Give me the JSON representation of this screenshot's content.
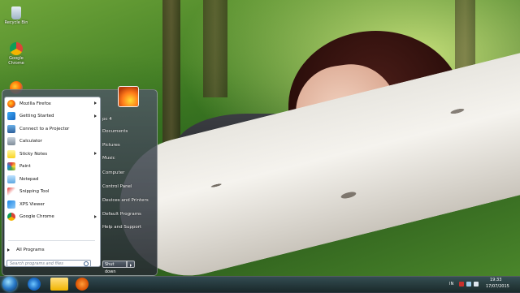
{
  "desktop": {
    "icons": [
      {
        "label": "Recycle Bin",
        "icon": "recycle-bin-icon"
      },
      {
        "label": "Google Chrome",
        "icon": "chrome-icon"
      },
      {
        "label": "",
        "icon": "firefox-icon"
      }
    ]
  },
  "start_menu": {
    "programs": [
      {
        "label": "Mozilla Firefox",
        "icon": "firefox-icon",
        "has_submenu": true
      },
      {
        "label": "Getting Started",
        "icon": "getting-started-icon",
        "has_submenu": true
      },
      {
        "label": "Connect to a Projector",
        "icon": "projector-icon",
        "has_submenu": false
      },
      {
        "label": "Calculator",
        "icon": "calculator-icon",
        "has_submenu": false
      },
      {
        "label": "Sticky Notes",
        "icon": "sticky-notes-icon",
        "has_submenu": true
      },
      {
        "label": "Paint",
        "icon": "paint-icon",
        "has_submenu": false
      },
      {
        "label": "Notepad",
        "icon": "notepad-icon",
        "has_submenu": false
      },
      {
        "label": "Snipping Tool",
        "icon": "snipping-tool-icon",
        "has_submenu": false
      },
      {
        "label": "XPS Viewer",
        "icon": "xps-viewer-icon",
        "has_submenu": false
      },
      {
        "label": "Google Chrome",
        "icon": "chrome-icon",
        "has_submenu": true
      }
    ],
    "all_programs_label": "All Programs",
    "search_placeholder": "Search programs and files",
    "right_items": [
      "pc 4",
      "Documents",
      "Pictures",
      "Music",
      "Computer",
      "Control Panel",
      "Devices and Printers",
      "Default Programs",
      "Help and Support"
    ],
    "shutdown_label": "Shut down"
  },
  "taskbar": {
    "pinned": [
      "internet-explorer-icon",
      "file-explorer-icon",
      "media-player-icon"
    ],
    "language": "IN",
    "time": "19:33",
    "date": "17/07/2015"
  },
  "colors": {
    "taskbar": "#1e2c3a",
    "start_orb": "#2a7bc9"
  }
}
